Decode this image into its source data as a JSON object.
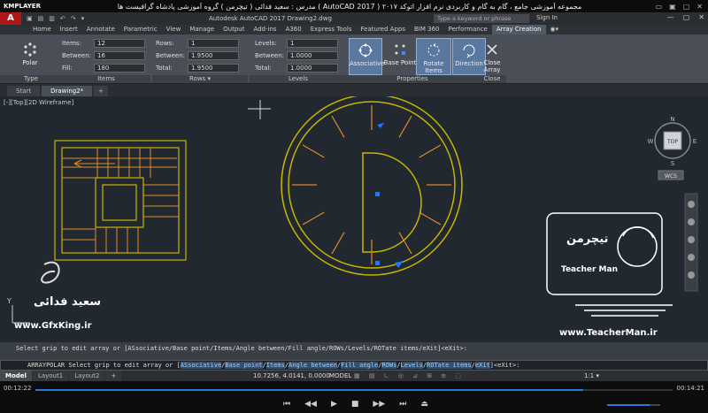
{
  "player": {
    "name": "KMPLAYER",
    "title": "مجموعه آموزشی جامع ، گام به گام و کاربردی نرم افزار   اتوکد ۲۰۱۷ ( AutoCAD 2017 )   مدرس : سعید فدائی ( تیچرمن ) گروه آموزشی پادشاه گرافیست ها",
    "controls": [
      "▭",
      "▣",
      "▢",
      "✕"
    ],
    "time_current": "00:12:22",
    "time_total": "00:14:21",
    "progress": 0.86,
    "volume": 0.8,
    "buttons": [
      "⏮",
      "◀◀",
      "▶",
      "■",
      "▶▶",
      "⏭",
      "⏏"
    ]
  },
  "acad": {
    "logo": "A",
    "title": "Autodesk AutoCAD 2017   Drawing2.dwg",
    "search_placeholder": "Type a keyword or phrase",
    "sign_in": "Sign In",
    "qat": [
      "▣",
      "▤",
      "▥",
      "↶",
      "↷",
      "▾"
    ],
    "window_controls": [
      "—",
      "▢",
      "✕"
    ]
  },
  "ribbon": {
    "tabs": [
      "Home",
      "Insert",
      "Annotate",
      "Parametric",
      "View",
      "Manage",
      "Output",
      "Add-ins",
      "A360",
      "Express Tools",
      "Featured Apps",
      "BIM 360",
      "Performance",
      "Array Creation",
      "◉▾"
    ],
    "active_tab": "Array Creation",
    "type_panel": {
      "button": "Polar",
      "label": "Type"
    },
    "items_panel": {
      "label": "Items",
      "fields": [
        {
          "label": "Items:",
          "value": "12"
        },
        {
          "label": "Between:",
          "value": "16"
        },
        {
          "label": "Fill:",
          "value": "180"
        }
      ]
    },
    "rows_panel": {
      "label": "Rows ▾",
      "fields": [
        {
          "label": "Rows:",
          "value": "1"
        },
        {
          "label": "Between:",
          "value": "1.9500"
        },
        {
          "label": "Total:",
          "value": "1.9500"
        }
      ]
    },
    "levels_panel": {
      "label": "Levels",
      "fields": [
        {
          "label": "Levels:",
          "value": "1"
        },
        {
          "label": "Between:",
          "value": "1.0000"
        },
        {
          "label": "Total:",
          "value": "1.0000"
        }
      ]
    },
    "properties_panel": {
      "label": "Properties",
      "buttons": [
        "Associative",
        "Base Point",
        "Rotate Items",
        "Direction"
      ]
    },
    "close_panel": {
      "button": "Close Array",
      "label": "Close"
    }
  },
  "doc_tabs": [
    "Start",
    "Drawing2*",
    "+"
  ],
  "viewport": {
    "label": "[-][Top][2D Wireframe]",
    "viewcube_top": "TOP",
    "compass": {
      "n": "N",
      "s": "S",
      "e": "E",
      "w": "W"
    },
    "wcs": "WCS",
    "axis_y": "Y"
  },
  "watermark": {
    "name_fa": "سعید فدائی",
    "site_left": "www.GfxKing.ir",
    "brand_fa": "تیچرمن",
    "brand_en": "Teacher Man",
    "site_right": "www.TeacherMan.ir"
  },
  "command": {
    "history": "Select grip to edit array or [ASsociative/Base point/Items/Angle between/Fill angle/ROWs/Levels/ROTate items/eXit]<eXit>:",
    "prompt_prefix": "ARRAYPOLAR Select grip to edit array or [",
    "options": [
      "ASsociative",
      "Base point",
      "Items",
      "Angle between",
      "Fill angle",
      "ROWs",
      "Levels",
      "ROTate items",
      "eXit"
    ],
    "prompt_suffix": "]<eXit>:",
    "icons": "✕ 🔧 ▸"
  },
  "status": {
    "layout_tabs": [
      "Model",
      "Layout1",
      "Layout2",
      "+"
    ],
    "coords": "10.7256, 4.0141, 0.0000",
    "mode": "MODEL",
    "icons": "▦ ▤ ∟ ◎ ⊿ ⊞ ≡ ⬚",
    "scale": "1:1 ▾"
  },
  "colors": {
    "accent": "#2a7ad8",
    "geometry_yellow": "#c8b400",
    "array_orange": "#e08a2a",
    "grip_blue": "#1e78ff",
    "canvas": "#212830"
  }
}
